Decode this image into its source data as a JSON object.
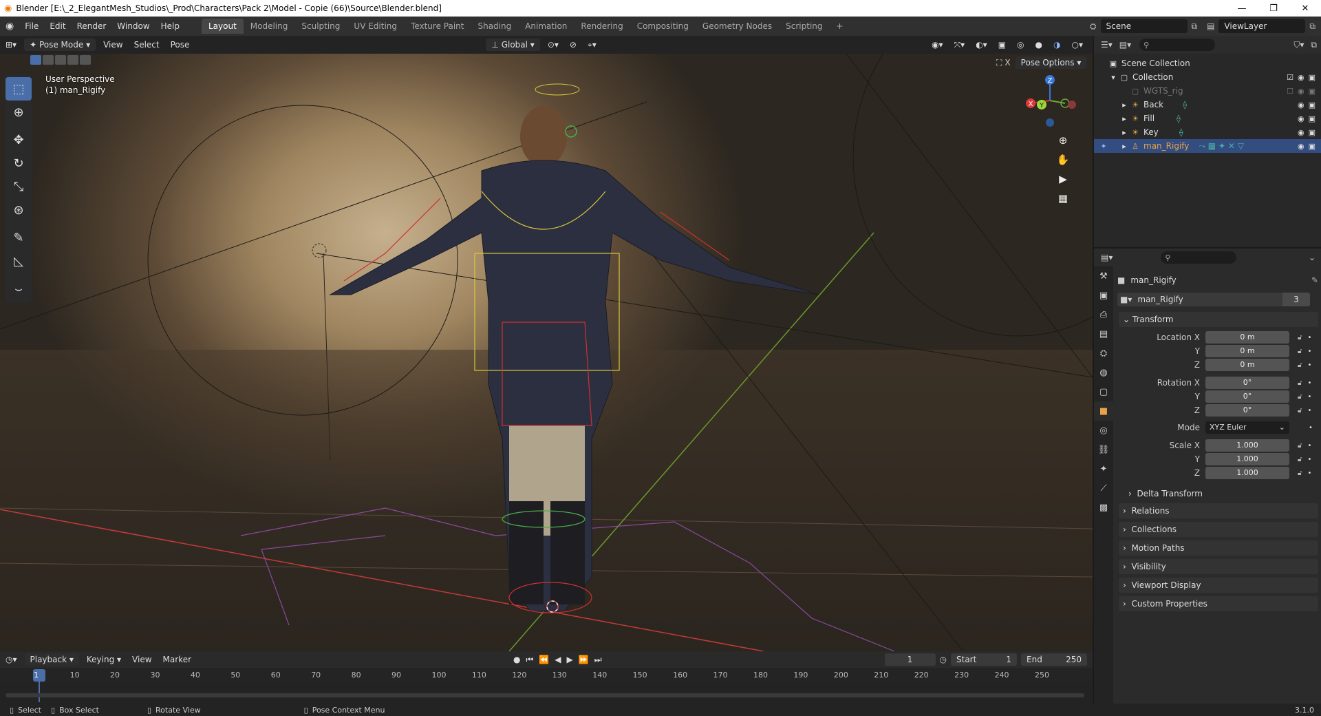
{
  "window": {
    "title": "Blender [E:\\_2_ElegantMesh_Studios\\_Prod\\Characters\\Pack 2\\Model - Copie (66)\\Source\\Blender.blend]",
    "controls": [
      "—",
      "❐",
      "✕"
    ]
  },
  "menu": [
    "File",
    "Edit",
    "Render",
    "Window",
    "Help"
  ],
  "workspaces": [
    "Layout",
    "Modeling",
    "Sculpting",
    "UV Editing",
    "Texture Paint",
    "Shading",
    "Animation",
    "Rendering",
    "Compositing",
    "Geometry Nodes",
    "Scripting"
  ],
  "active_workspace": "Layout",
  "add_workspace": "+",
  "scene": "Scene",
  "view_layer": "ViewLayer",
  "viewport_header": {
    "mode": "Pose Mode",
    "menus": [
      "View",
      "Select",
      "Pose"
    ],
    "orientation": "Global",
    "pose_options": "Pose Options"
  },
  "viewport": {
    "perspective": "User Perspective",
    "object": "(1) man_Rigify",
    "gizmo_axes": [
      "X",
      "Y",
      "Z"
    ]
  },
  "tools": [
    "select-box",
    "cursor",
    "move",
    "rotate",
    "scale",
    "transform",
    "annotate",
    "measure",
    "bone-curve"
  ],
  "outliner": {
    "root": "Scene Collection",
    "collection": "Collection",
    "items": [
      {
        "name": "WGTS_rig",
        "dim": true
      },
      {
        "name": "Back",
        "dim": false
      },
      {
        "name": "Fill",
        "dim": false
      },
      {
        "name": "Key",
        "dim": false
      },
      {
        "name": "man_Rigify",
        "dim": false,
        "selected": true
      }
    ]
  },
  "properties": {
    "object_name": "man_Rigify",
    "datablock": "man_Rigify",
    "users": "3",
    "transform_label": "Transform",
    "location": {
      "label": "Location X",
      "x": "0 m",
      "y": "0 m",
      "z": "0 m"
    },
    "rotation": {
      "label": "Rotation X",
      "x": "0°",
      "y": "0°",
      "z": "0°"
    },
    "axis_labels": [
      "Y",
      "Z"
    ],
    "mode_label": "Mode",
    "mode_value": "XYZ Euler",
    "scale": {
      "label": "Scale X",
      "x": "1.000",
      "y": "1.000",
      "z": "1.000"
    },
    "delta": "Delta Transform",
    "panels": [
      "Relations",
      "Collections",
      "Motion Paths",
      "Visibility",
      "Viewport Display",
      "Custom Properties"
    ]
  },
  "timeline": {
    "menus": [
      "Playback",
      "Keying",
      "View",
      "Marker"
    ],
    "current_frame": "1",
    "start_label": "Start",
    "start": "1",
    "end_label": "End",
    "end": "250",
    "ticks": [
      "1",
      "10",
      "20",
      "30",
      "40",
      "50",
      "60",
      "70",
      "80",
      "90",
      "100",
      "110",
      "120",
      "130",
      "140",
      "150",
      "160",
      "170",
      "180",
      "190",
      "200",
      "210",
      "220",
      "230",
      "240",
      "250"
    ]
  },
  "status": {
    "items": [
      "Select",
      "Box Select",
      "Rotate View",
      "Pose Context Menu"
    ],
    "version": "3.1.0"
  },
  "colors": {
    "accent": "#4a6ea8",
    "selection": "#334d80",
    "orange": "#e9a248"
  }
}
